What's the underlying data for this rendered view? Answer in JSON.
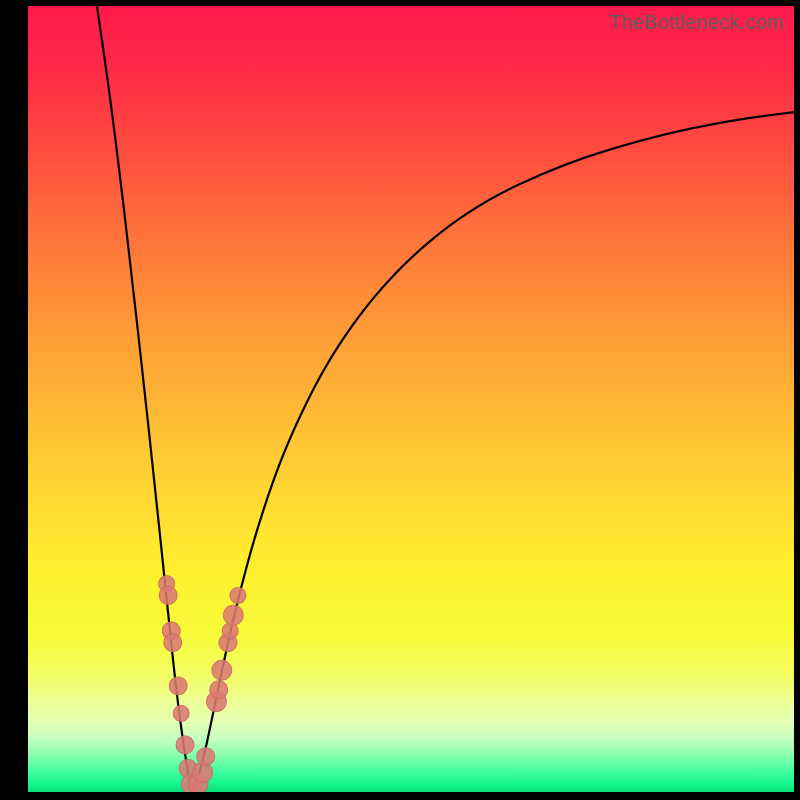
{
  "watermark": "TheBottleneck.com",
  "colors": {
    "curve_stroke": "#000000",
    "bead_fill": "#d97a72"
  },
  "chart_data": {
    "type": "line",
    "title": "",
    "xlabel": "",
    "ylabel": "",
    "xlim": [
      0,
      100
    ],
    "ylim": [
      0,
      100
    ],
    "series": [
      {
        "name": "left-branch",
        "x": [
          9.0,
          10.5,
          12.0,
          13.5,
          15.0,
          16.5,
          18.0,
          19.5,
          21.0,
          21.6
        ],
        "y": [
          100.0,
          90.0,
          78.5,
          66.0,
          53.0,
          39.5,
          25.5,
          11.5,
          1.5,
          0.0
        ]
      },
      {
        "name": "right-branch",
        "x": [
          21.6,
          23.0,
          25.0,
          27.0,
          30.0,
          34.0,
          40.0,
          48.0,
          58.0,
          70.0,
          82.0,
          92.0,
          100.0
        ],
        "y": [
          0.0,
          4.5,
          14.0,
          23.0,
          34.0,
          45.0,
          56.5,
          66.5,
          74.5,
          80.0,
          83.5,
          85.5,
          86.5
        ]
      }
    ],
    "markers": {
      "name": "bead-cluster",
      "points_xy": [
        [
          18.1,
          26.5
        ],
        [
          18.3,
          25.0
        ],
        [
          18.7,
          20.5
        ],
        [
          18.9,
          19.0
        ],
        [
          19.6,
          13.5
        ],
        [
          20.0,
          10.0
        ],
        [
          20.5,
          6.0
        ],
        [
          20.9,
          3.0
        ],
        [
          21.3,
          1.0
        ],
        [
          22.2,
          1.0
        ],
        [
          22.8,
          2.5
        ],
        [
          23.2,
          4.5
        ],
        [
          24.6,
          11.5
        ],
        [
          24.9,
          13.0
        ],
        [
          25.3,
          15.5
        ],
        [
          26.1,
          19.0
        ],
        [
          26.4,
          20.5
        ],
        [
          26.8,
          22.5
        ],
        [
          27.4,
          25.0
        ]
      ],
      "radius": [
        8,
        9,
        9,
        9,
        9,
        8,
        9,
        9,
        10,
        10,
        10,
        9,
        10,
        9,
        10,
        9,
        8,
        10,
        8
      ]
    }
  }
}
